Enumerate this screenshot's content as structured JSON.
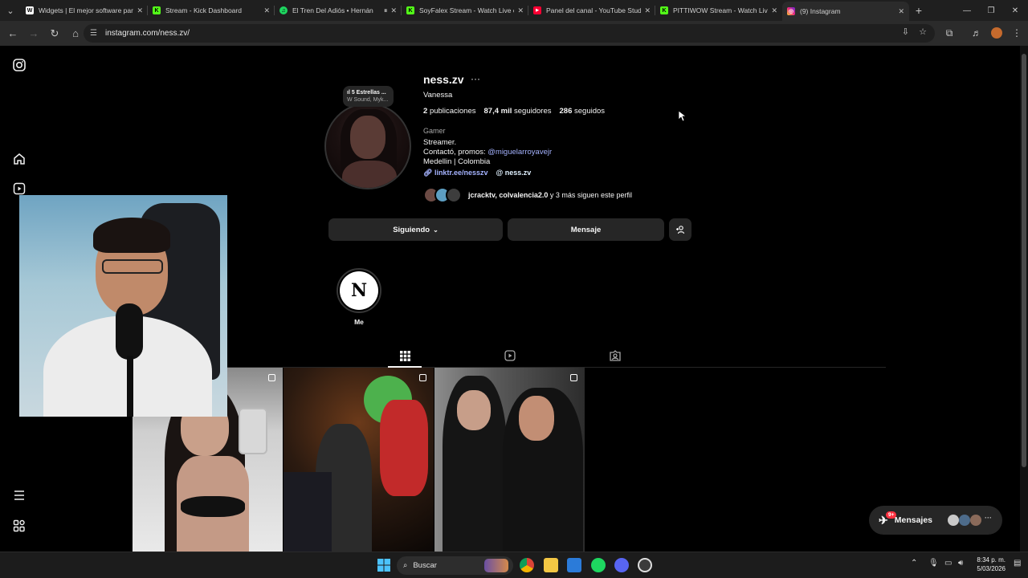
{
  "browser": {
    "tabs": [
      {
        "title": "Widgets | El mejor software para",
        "color": "#ffffff",
        "glyph": "W"
      },
      {
        "title": "Stream - Kick Dashboard",
        "color": "#53fc18",
        "glyph": "K"
      },
      {
        "title": "El Tren Del Adiós • Hernán",
        "color": "#1ed760",
        "glyph": "♫"
      },
      {
        "title": "SoyFalex Stream - Watch Live on",
        "color": "#53fc18",
        "glyph": "K"
      },
      {
        "title": "Panel del canal - YouTube Studio",
        "color": "#ff0033",
        "glyph": "▶"
      },
      {
        "title": "PITTIWOW Stream - Watch Live on",
        "color": "#53fc18",
        "glyph": "K"
      },
      {
        "title": "(9) Instagram",
        "color": "#e1306c",
        "glyph": "◎"
      }
    ],
    "url": "instagram.com/ness.zv/"
  },
  "profile": {
    "username": "ness.zv",
    "more": "···",
    "full_name": "Vanessa",
    "note_title": "5 Estrellas ...",
    "note_sub": "W Sound, Myk...",
    "posts_count": "2",
    "posts_label": "publicaciones",
    "followers_count": "87,4 mil",
    "followers_label": "seguidores",
    "following_count": "286",
    "following_label": "seguidos",
    "category": "Gamer",
    "bio_line1": "Streamer.",
    "bio_line2_prefix": "Contactó, promos: ",
    "bio_mention": "@miguelarroyavejr",
    "bio_line3": "Medellin | Colombia",
    "link": "linktr.ee/nesszv",
    "threads": "ness.zv",
    "followed_by_names": "jcracktv, colvalencia2.0",
    "followed_by_rest": " y 3 más siguen este perfil",
    "follow_button": "Siguiendo",
    "message_button": "Mensaje",
    "highlight_label": "Me",
    "highlight_glyph": "N"
  },
  "messages_pill": {
    "label": "Mensajes",
    "count": "9+"
  },
  "taskbar": {
    "search_placeholder": "Buscar",
    "time": "8:34 p. m.",
    "date": "5/03/2026"
  }
}
